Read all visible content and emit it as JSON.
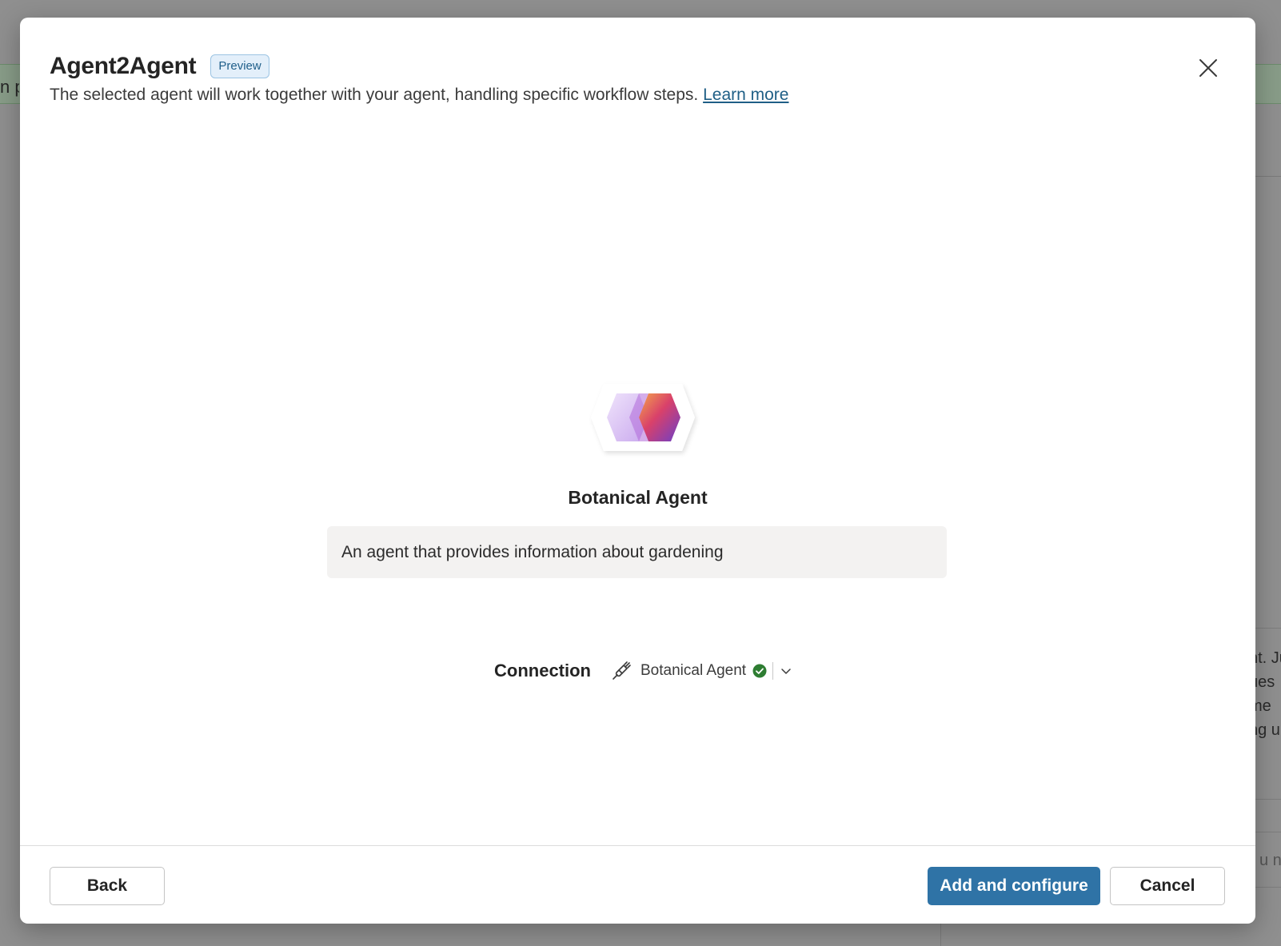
{
  "background": {
    "left_fragment": "n pr",
    "right_fragments": [
      "nt. Ju",
      "ues",
      "me",
      "ng u"
    ],
    "input_fragment": "u ne"
  },
  "dialog": {
    "title": "Agent2Agent",
    "badge": "Preview",
    "subtitle": "The selected agent will work together with your agent, handling specific workflow steps.",
    "learn_more": "Learn more",
    "close_icon": "close-icon"
  },
  "agent": {
    "name": "Botanical Agent",
    "description": "An agent that provides information about gardening",
    "logo_icon": "copilot-studio-logo"
  },
  "connection": {
    "label": "Connection",
    "value": "Botanical Agent",
    "status": "connected",
    "icons": [
      "plug-icon",
      "check-circle-icon",
      "chevron-down-icon"
    ]
  },
  "footer": {
    "back_label": "Back",
    "add_label": "Add and configure",
    "cancel_label": "Cancel"
  },
  "colors": {
    "primary": "#2f73a6",
    "badge_bg": "#e3effa",
    "badge_text": "#205f8a",
    "link": "#1f5f86",
    "success": "#2e7d32",
    "overlay": "#8f8f8f"
  }
}
